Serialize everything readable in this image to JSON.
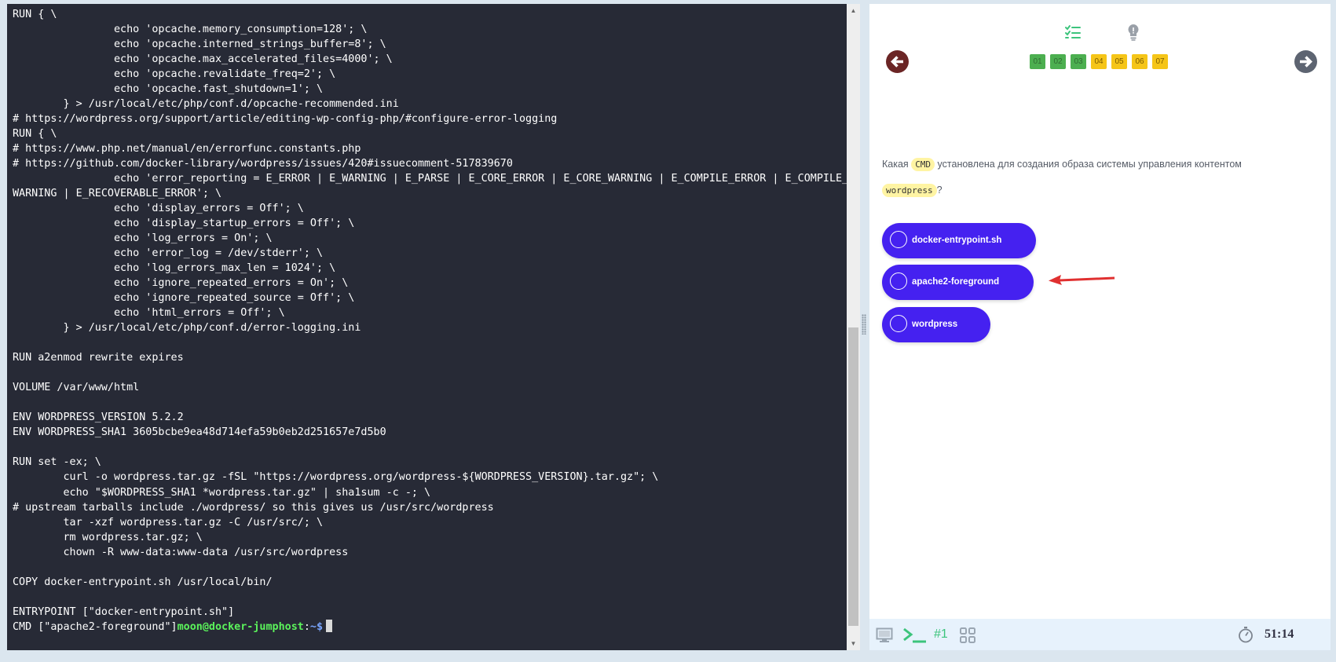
{
  "terminal": {
    "lines": [
      "RUN { \\",
      "\t\techo 'opcache.memory_consumption=128'; \\",
      "\t\techo 'opcache.interned_strings_buffer=8'; \\",
      "\t\techo 'opcache.max_accelerated_files=4000'; \\",
      "\t\techo 'opcache.revalidate_freq=2'; \\",
      "\t\techo 'opcache.fast_shutdown=1'; \\",
      "\t} > /usr/local/etc/php/conf.d/opcache-recommended.ini",
      "# https://wordpress.org/support/article/editing-wp-config-php/#configure-error-logging",
      "RUN { \\",
      "# https://www.php.net/manual/en/errorfunc.constants.php",
      "# https://github.com/docker-library/wordpress/issues/420#issuecomment-517839670",
      "\t\techo 'error_reporting = E_ERROR | E_WARNING | E_PARSE | E_CORE_ERROR | E_CORE_WARNING | E_COMPILE_ERROR | E_COMPILE_",
      "WARNING | E_RECOVERABLE_ERROR'; \\",
      "\t\techo 'display_errors = Off'; \\",
      "\t\techo 'display_startup_errors = Off'; \\",
      "\t\techo 'log_errors = On'; \\",
      "\t\techo 'error_log = /dev/stderr'; \\",
      "\t\techo 'log_errors_max_len = 1024'; \\",
      "\t\techo 'ignore_repeated_errors = On'; \\",
      "\t\techo 'ignore_repeated_source = Off'; \\",
      "\t\techo 'html_errors = Off'; \\",
      "\t} > /usr/local/etc/php/conf.d/error-logging.ini",
      "",
      "RUN a2enmod rewrite expires",
      "",
      "VOLUME /var/www/html",
      "",
      "ENV WORDPRESS_VERSION 5.2.2",
      "ENV WORDPRESS_SHA1 3605bcbe9ea48d714efa59b0eb2d251657e7d5b0",
      "",
      "RUN set -ex; \\",
      "\tcurl -o wordpress.tar.gz -fSL \"https://wordpress.org/wordpress-${WORDPRESS_VERSION}.tar.gz\"; \\",
      "\techo \"$WORDPRESS_SHA1 *wordpress.tar.gz\" | sha1sum -c -; \\",
      "# upstream tarballs include ./wordpress/ so this gives us /usr/src/wordpress",
      "\ttar -xzf wordpress.tar.gz -C /usr/src/; \\",
      "\trm wordpress.tar.gz; \\",
      "\tchown -R www-data:www-data /usr/src/wordpress",
      "",
      "COPY docker-entrypoint.sh /usr/local/bin/",
      "",
      "ENTRYPOINT [\"docker-entrypoint.sh\"]"
    ],
    "last_line_text": "CMD [\"apache2-foreground\"]",
    "prompt_user": "moon@docker-jumphost",
    "prompt_sep": ":",
    "prompt_path": "~$"
  },
  "quiz": {
    "steps": [
      {
        "label": "01",
        "status": "done"
      },
      {
        "label": "02",
        "status": "done"
      },
      {
        "label": "03",
        "status": "done"
      },
      {
        "label": "04",
        "status": "pending"
      },
      {
        "label": "05",
        "status": "pending"
      },
      {
        "label": "06",
        "status": "pending"
      },
      {
        "label": "07",
        "status": "pending"
      }
    ],
    "question": {
      "part1": "Какая",
      "chip1": "CMD",
      "part2": "установлена для создания образа системы управления контентом",
      "chip2": "wordpress",
      "part3": "?"
    },
    "answers": [
      {
        "label": "docker-entrypoint.sh"
      },
      {
        "label": "apache2-foreground"
      },
      {
        "label": "wordpress"
      }
    ]
  },
  "toolbar": {
    "session_label": "#1",
    "timer": "51:14"
  },
  "icons": {
    "tab_list": "checklist-icon",
    "tab_hint": "lightbulb-icon",
    "prev": "arrow-left-icon",
    "next": "arrow-right-icon",
    "desktop": "monitor-icon",
    "terminal": "terminal-icon",
    "apps": "grid-icon",
    "timer": "stopwatch-icon"
  },
  "colors": {
    "terminal_bg": "#272a36",
    "answer_button": "#4521f0",
    "step_done": "#4caf50",
    "step_pending": "#f5c518",
    "prev_button": "#6b2525",
    "next_button": "#5d6471",
    "annotation_arrow": "#e03030"
  }
}
